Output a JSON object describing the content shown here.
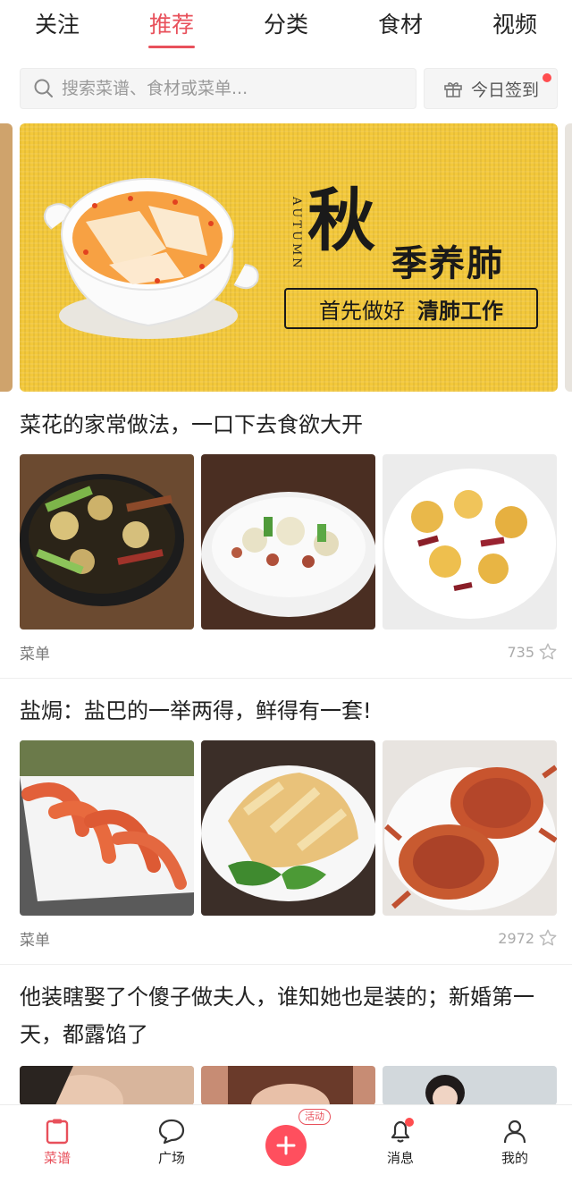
{
  "top_tabs": [
    {
      "label": "关注",
      "active": false
    },
    {
      "label": "推荐",
      "active": true
    },
    {
      "label": "分类",
      "active": false
    },
    {
      "label": "食材",
      "active": false
    },
    {
      "label": "视频",
      "active": false
    }
  ],
  "search": {
    "placeholder": "搜索菜谱、食材或菜单..."
  },
  "checkin": {
    "label": "今日签到",
    "icon": "gift-icon",
    "has_dot": true
  },
  "banner": {
    "autumn_text": "AUTUMN",
    "big_char": "秋",
    "subtitle": "季养肺",
    "box_text_1": "首先做好",
    "box_text_2": "清肺工作"
  },
  "feed": [
    {
      "title": "菜花的家常做法，一口下去食欲大开",
      "type_label": "菜单",
      "count": "735",
      "images": [
        "cauliflower-pork-skillet",
        "cauliflower-peanut-bowl",
        "cauliflower-chili-plate"
      ]
    },
    {
      "title": "盐焗：盐巴的一举两得，鲜得有一套!",
      "type_label": "菜单",
      "count": "2972",
      "images": [
        "salt-baked-shrimp",
        "salt-baked-chicken",
        "salt-baked-crab"
      ]
    },
    {
      "title": "他装瞎娶了个傻子做夫人，谁知她也是装的；新婚第一天，都露馅了",
      "images": [
        "drama-still-1",
        "drama-still-2",
        "drama-still-3"
      ]
    }
  ],
  "bottom_nav": [
    {
      "label": "菜谱",
      "icon": "recipe-icon",
      "active": true
    },
    {
      "label": "广场",
      "icon": "chat-bubble-icon",
      "active": false
    },
    {
      "label": "",
      "icon": "plus-icon",
      "badge": "活动"
    },
    {
      "label": "消息",
      "icon": "bell-icon",
      "active": false,
      "has_dot": true
    },
    {
      "label": "我的",
      "icon": "person-icon",
      "active": false
    }
  ],
  "colors": {
    "accent": "#e8505b",
    "banner_yellow": "#f3c83a",
    "plus": "#ff4f5e"
  }
}
